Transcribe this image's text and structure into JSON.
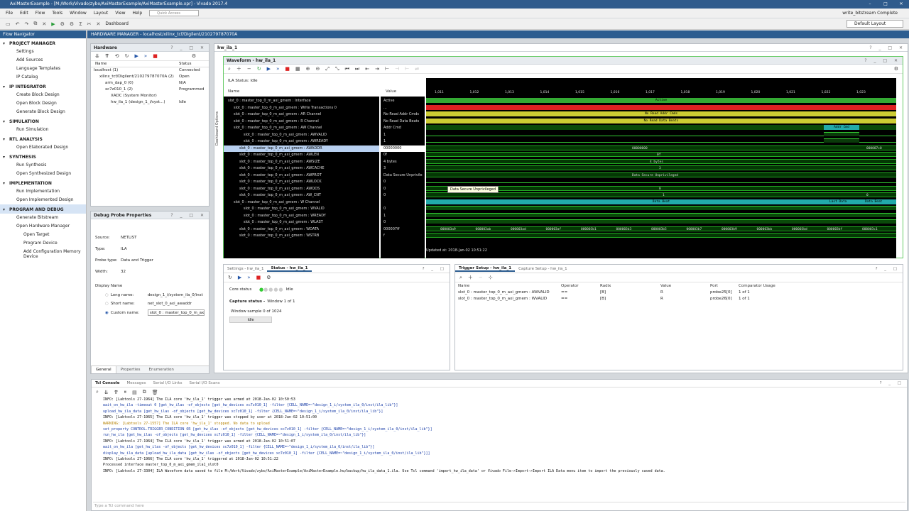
{
  "window": {
    "title": "AxiMasterExample - [M:/Work/Vivado/zybo/AxiMasterExample/AxiMasterExample.xpr] - Vivado 2017.4"
  },
  "menu": [
    "File",
    "Edit",
    "Flow",
    "Tools",
    "Window",
    "Layout",
    "View",
    "Help"
  ],
  "quick_access": "Quick Access",
  "status_right": "write_bitstream Complete",
  "toolbar": {
    "dashboard": "Dashboard"
  },
  "layout_dropdown": "Default Layout",
  "flow_navigator": {
    "title": "Flow Navigator",
    "sections": [
      {
        "name": "PROJECT MANAGER",
        "items": [
          "Settings",
          "Add Sources",
          "Language Templates",
          "IP Catalog"
        ]
      },
      {
        "name": "IP INTEGRATOR",
        "items": [
          "Create Block Design",
          "Open Block Design",
          "Generate Block Design"
        ]
      },
      {
        "name": "SIMULATION",
        "items": [
          "Run Simulation"
        ]
      },
      {
        "name": "RTL ANALYSIS",
        "items": [
          "Open Elaborated Design"
        ]
      },
      {
        "name": "SYNTHESIS",
        "items": [
          "Run Synthesis",
          "Open Synthesized Design"
        ]
      },
      {
        "name": "IMPLEMENTATION",
        "items": [
          "Run Implementation",
          "Open Implemented Design"
        ]
      },
      {
        "name": "PROGRAM AND DEBUG",
        "items": [
          "Generate Bitstream",
          "Open Hardware Manager"
        ],
        "subitems": [
          "Open Target",
          "Program Device",
          "Add Configuration Memory Device"
        ]
      }
    ]
  },
  "hw_manager_header": "HARDWARE MANAGER - localhost/xilinx_tcf/Digilent/210279787070A",
  "hardware": {
    "title": "Hardware",
    "col_name": "Name",
    "col_status": "Status",
    "rows": [
      {
        "name": "localhost (1)",
        "status": "Connected"
      },
      {
        "name": "xilinx_tcf/Digilent/210279787070A (2)",
        "status": "Open"
      },
      {
        "name": "arm_dap_0 (0)",
        "status": "N/A"
      },
      {
        "name": "xc7z010_1 (2)",
        "status": "Programmed"
      },
      {
        "name": "XADC (System Monitor)",
        "status": ""
      },
      {
        "name": "hw_ila_1 (design_1_i/syst...)",
        "status": "Idle"
      }
    ]
  },
  "probe_props": {
    "title": "Debug Probe Properties",
    "source_label": "Source:",
    "source": "NETLIST",
    "type_label": "Type:",
    "type": "ILA",
    "probe_type_label": "Probe type:",
    "probe_type": "Data and Trigger",
    "width_label": "Width:",
    "width": "32",
    "display_name": "Display Name",
    "long_label": "Long name:",
    "long": "design_1_i/system_ila_0/inst",
    "short_label": "Short name:",
    "short": "net_slot_0_axi_awaddr",
    "custom_label": "Custom name:",
    "custom": "slot_0 : master_top_0_m_axi",
    "tabs": [
      "General",
      "Properties",
      "Enumeration"
    ]
  },
  "ila_tab": "hw_ila_1",
  "waveform": {
    "title": "Waveform - hw_ila_1",
    "side_label": "Dashboard Options",
    "ila_status": "ILA Status: Idle",
    "col_name": "Name",
    "col_value": "Value",
    "ticks": [
      "1,011",
      "1,012",
      "1,013",
      "1,014",
      "1,015",
      "1,016",
      "1,017",
      "1,018",
      "1,019",
      "1,020",
      "1,021",
      "1,022",
      "1,023"
    ],
    "signals": [
      {
        "name": "slot_0 : master_top_0_m_axi_gmem : Interface",
        "value": "Active"
      },
      {
        "name": "slot_0 : master_top_0_m_axi_gmem : Write Transactions 0",
        "value": "..."
      },
      {
        "name": "slot_0 : master_top_0_m_axi_gmem : AR Channel",
        "value": "No Read Addr Cmds"
      },
      {
        "name": "slot_0 : master_top_0_m_axi_gmem : R Channel",
        "value": "No Read Data Beats"
      },
      {
        "name": "slot_0 : master_top_0_m_axi_gmem : AW Channel",
        "value": "Addr Cmd"
      },
      {
        "name": "slot_0 : master_top_0_m_axi_gmem : AWVALID",
        "value": "1"
      },
      {
        "name": "slot_0 : master_top_0_m_axi_gmem : AWREADY",
        "value": "1"
      },
      {
        "name": "slot_0 : master_top_0_m_axi_gmem : AWADDR",
        "value": "00000000"
      },
      {
        "name": "slot_0 : master_top_0_m_axi_gmem : AWLEN",
        "value": "0f"
      },
      {
        "name": "slot_0 : master_top_0_m_axi_gmem : AWSIZE",
        "value": "4 bytes"
      },
      {
        "name": "slot_0 : master_top_0_m_axi_gmem : AWCACHE",
        "value": "3"
      },
      {
        "name": "slot_0 : master_top_0_m_axi_gmem : AWPROT",
        "value": "Data Secure Unprivile"
      },
      {
        "name": "slot_0 : master_top_0_m_axi_gmem : AWLOCK",
        "value": "0"
      },
      {
        "name": "slot_0 : master_top_0_m_axi_gmem : AWQOS",
        "value": "0"
      },
      {
        "name": "slot_0 : master_top_0_m_axi_gmem : AW_CNT",
        "value": "0"
      },
      {
        "name": "slot_0 : master_top_0_m_axi_gmem : W Channel",
        "value": ""
      },
      {
        "name": "slot_0 : master_top_0_m_axi_gmem : WVALID",
        "value": "0"
      },
      {
        "name": "slot_0 : master_top_0_m_axi_gmem : WREADY",
        "value": "1"
      },
      {
        "name": "slot_0 : master_top_0_m_axi_gmem : WLAST",
        "value": "0"
      },
      {
        "name": "slot_0 : master_top_0_m_axi_gmem : WDATA",
        "value": "000007ff"
      },
      {
        "name": "slot_0 : master_top_0_m_axi_gmem : WSTRB",
        "value": "f"
      }
    ],
    "bar_labels": {
      "active": "Active",
      "no_read_addr": "No Read Addr Cmds",
      "no_read_data": "No Read Data Beats",
      "addr_cmd": "Addr Cmd",
      "awaddr": "00000000",
      "awaddr_end": "000007c0",
      "awlen": "0f",
      "awsize": "4 bytes",
      "awcache": "3",
      "awprot": "Data Secure Unprivileged",
      "awqos": "0",
      "awcnt": "1",
      "awcnt_end": "0",
      "data_beat": "Data Beat",
      "last_data": "Last Data",
      "data_beat2": "Data Beat"
    },
    "wdata_values": [
      "000003a9",
      "000003ab",
      "000003ad",
      "000003af",
      "000003b1",
      "000003b3",
      "000003b5",
      "000003b7",
      "000003b9",
      "000003bb",
      "000003bd",
      "000003bf",
      "000003c1"
    ],
    "tooltip": "Data Secure Unprivileged",
    "updated": "Updated at: 2018-Jan-02 10:51:22"
  },
  "status_panel": {
    "tabs": [
      "Settings - hw_ila_1",
      "Status - hw_ila_1"
    ],
    "core_status": "Core status",
    "core_value": "Idle",
    "capture_status": "Capture status - ",
    "capture_window": "Window 1 of 1",
    "window_sample": "Window sample 0 of 1024",
    "idle_btn": "Idle"
  },
  "trigger_panel": {
    "tabs": [
      "Trigger Setup - hw_ila_1",
      "Capture Setup - hw_ila_1"
    ],
    "cols": [
      "Name",
      "Operator",
      "Radix",
      "Value",
      "Port",
      "Comparator Usage"
    ],
    "rows": [
      [
        "slot_0 : master_top_0_m_axi_gmem : AWVALID",
        "==",
        "[B]",
        "R",
        "probe25[0]",
        "1 of 1"
      ],
      [
        "slot_0 : master_top_0_m_axi_gmem : WVALID",
        "==",
        "[B]",
        "R",
        "probe26[0]",
        "1 of 1"
      ]
    ]
  },
  "tcl": {
    "tabs": [
      "Tcl Console",
      "Messages",
      "Serial I/O Links",
      "Serial I/O Scans"
    ],
    "lines": [
      {
        "t": "",
        "c": "INFO: [Labtools 27-1964] The ILA core 'hw_ila_1' trigger was armed at 2018-Jan-02 10:50:53"
      },
      {
        "t": "cmd",
        "c": "wait_on_hw_ila -timeout 0 [get_hw_ilas -of_objects [get_hw_devices xc7z010_1] -filter {CELL_NAME=~\"design_1_i/system_ila_0/inst/ila_lib\"}]"
      },
      {
        "t": "cmd",
        "c": "upload_hw_ila_data [get_hw_ilas -of_objects [get_hw_devices xc7z010_1] -filter {CELL_NAME=~\"design_1_i/system_ila_0/inst/ila_lib\"}]"
      },
      {
        "t": "",
        "c": "INFO: [Labtools 27-1965] The ILA core 'hw_ila_1' trigger was stopped by user at 2018-Jan-02 10:51:00"
      },
      {
        "t": "warn",
        "c": "WARNING: [Labtools 27-1557] The ILA core 'hw_ila_1' stopped. No data to upload"
      },
      {
        "t": "cmd",
        "c": "set_property CONTROL.TRIGGER_CONDITION OR [get_hw_ilas -of_objects [get_hw_devices xc7z010_1] -filter {CELL_NAME=~\"design_1_i/system_ila_0/inst/ila_lib\"}]"
      },
      {
        "t": "cmd",
        "c": "run_hw_ila [get_hw_ilas -of_objects [get_hw_devices xc7z010_1] -filter {CELL_NAME=~\"design_1_i/system_ila_0/inst/ila_lib\"}]"
      },
      {
        "t": "",
        "c": "INFO: [Labtools 27-1964] The ILA core 'hw_ila_1' trigger was armed at 2018-Jan-02 10:51:07"
      },
      {
        "t": "cmd",
        "c": "wait_on_hw_ila [get_hw_ilas -of_objects [get_hw_devices xc7z010_1] -filter {CELL_NAME=~\"design_1_i/system_ila_0/inst/ila_lib\"}]"
      },
      {
        "t": "cmd",
        "c": "display_hw_ila_data [upload_hw_ila_data [get_hw_ilas -of_objects [get_hw_devices xc7z010_1] -filter {CELL_NAME=~\"design_1_i/system_ila_0/inst/ila_lib\"}]]"
      },
      {
        "t": "",
        "c": "INFO: [Labtools 27-1966] The ILA core 'hw_ila_1' triggered at 2018-Jan-02 10:51:22"
      },
      {
        "t": "",
        "c": "Processed interface master_top_0_m_axi_gmem_ila1_slot0"
      },
      {
        "t": "",
        "c": "INFO: [Labtools 27-3304] ILA Waveform data saved to file M:/Work/Vivado/zybo/AxiMasterExample/AxiMasterExample.hw/backup/hw_ila_data_1.ila. Use Tcl command 'import_hw_ila_data' or Vivado File->Import->Import ILA Data menu item to import the previously saved data."
      }
    ],
    "placeholder": "Type a Tcl command here"
  }
}
